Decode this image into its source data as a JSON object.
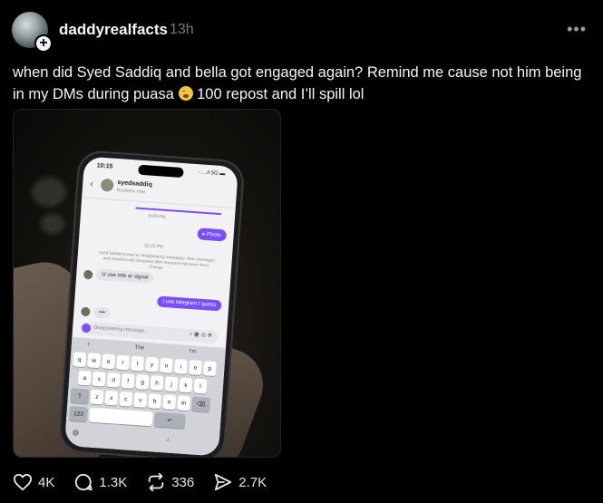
{
  "post": {
    "username": "daddyrealfacts",
    "timestamp": "13h",
    "text_before_emoji": "when did Syed Saddiq and bella got engaged again? Remind me cause not him being in my DMs during puasa",
    "text_after_emoji": "100 repost and I’ll spill lol",
    "emoji": "yawning-face"
  },
  "screenshot_phone": {
    "status_time": "10:15",
    "status_icons": "··…ıl 5G ▬",
    "dm_name": "syedsaddiq",
    "dm_subtitle": "Business chat",
    "time_1": "8:29 PM",
    "photo_label": "▸ Photo",
    "time_2": "10:15 PM",
    "system_message": "Syed Saddiq turned on disappearing messages. New messages and reactions will disappear after everyone has seen them. Change",
    "incoming_message": "U use tele or signal",
    "outgoing_message": "I use telegram I guess",
    "typing": "•••",
    "composer_placeholder": "Disappearing message...",
    "keyboard_suggestions": [
      "I",
      "The",
      "I'm"
    ],
    "row1": [
      "q",
      "w",
      "e",
      "r",
      "t",
      "y",
      "u",
      "i",
      "o",
      "p"
    ],
    "row2": [
      "a",
      "s",
      "d",
      "f",
      "g",
      "h",
      "j",
      "k",
      "l"
    ],
    "row3": [
      "⇧",
      "z",
      "x",
      "c",
      "v",
      "b",
      "n",
      "m",
      "⌫"
    ],
    "numbers_key": "123",
    "return_key": "↵"
  },
  "actions": {
    "likes": "4K",
    "comments": "1.3K",
    "reposts": "336",
    "shares": "2.7K"
  },
  "icons": {
    "more": "more-options-icon",
    "like": "heart-icon",
    "comment": "comment-icon",
    "repost": "repost-icon",
    "share": "share-icon"
  }
}
